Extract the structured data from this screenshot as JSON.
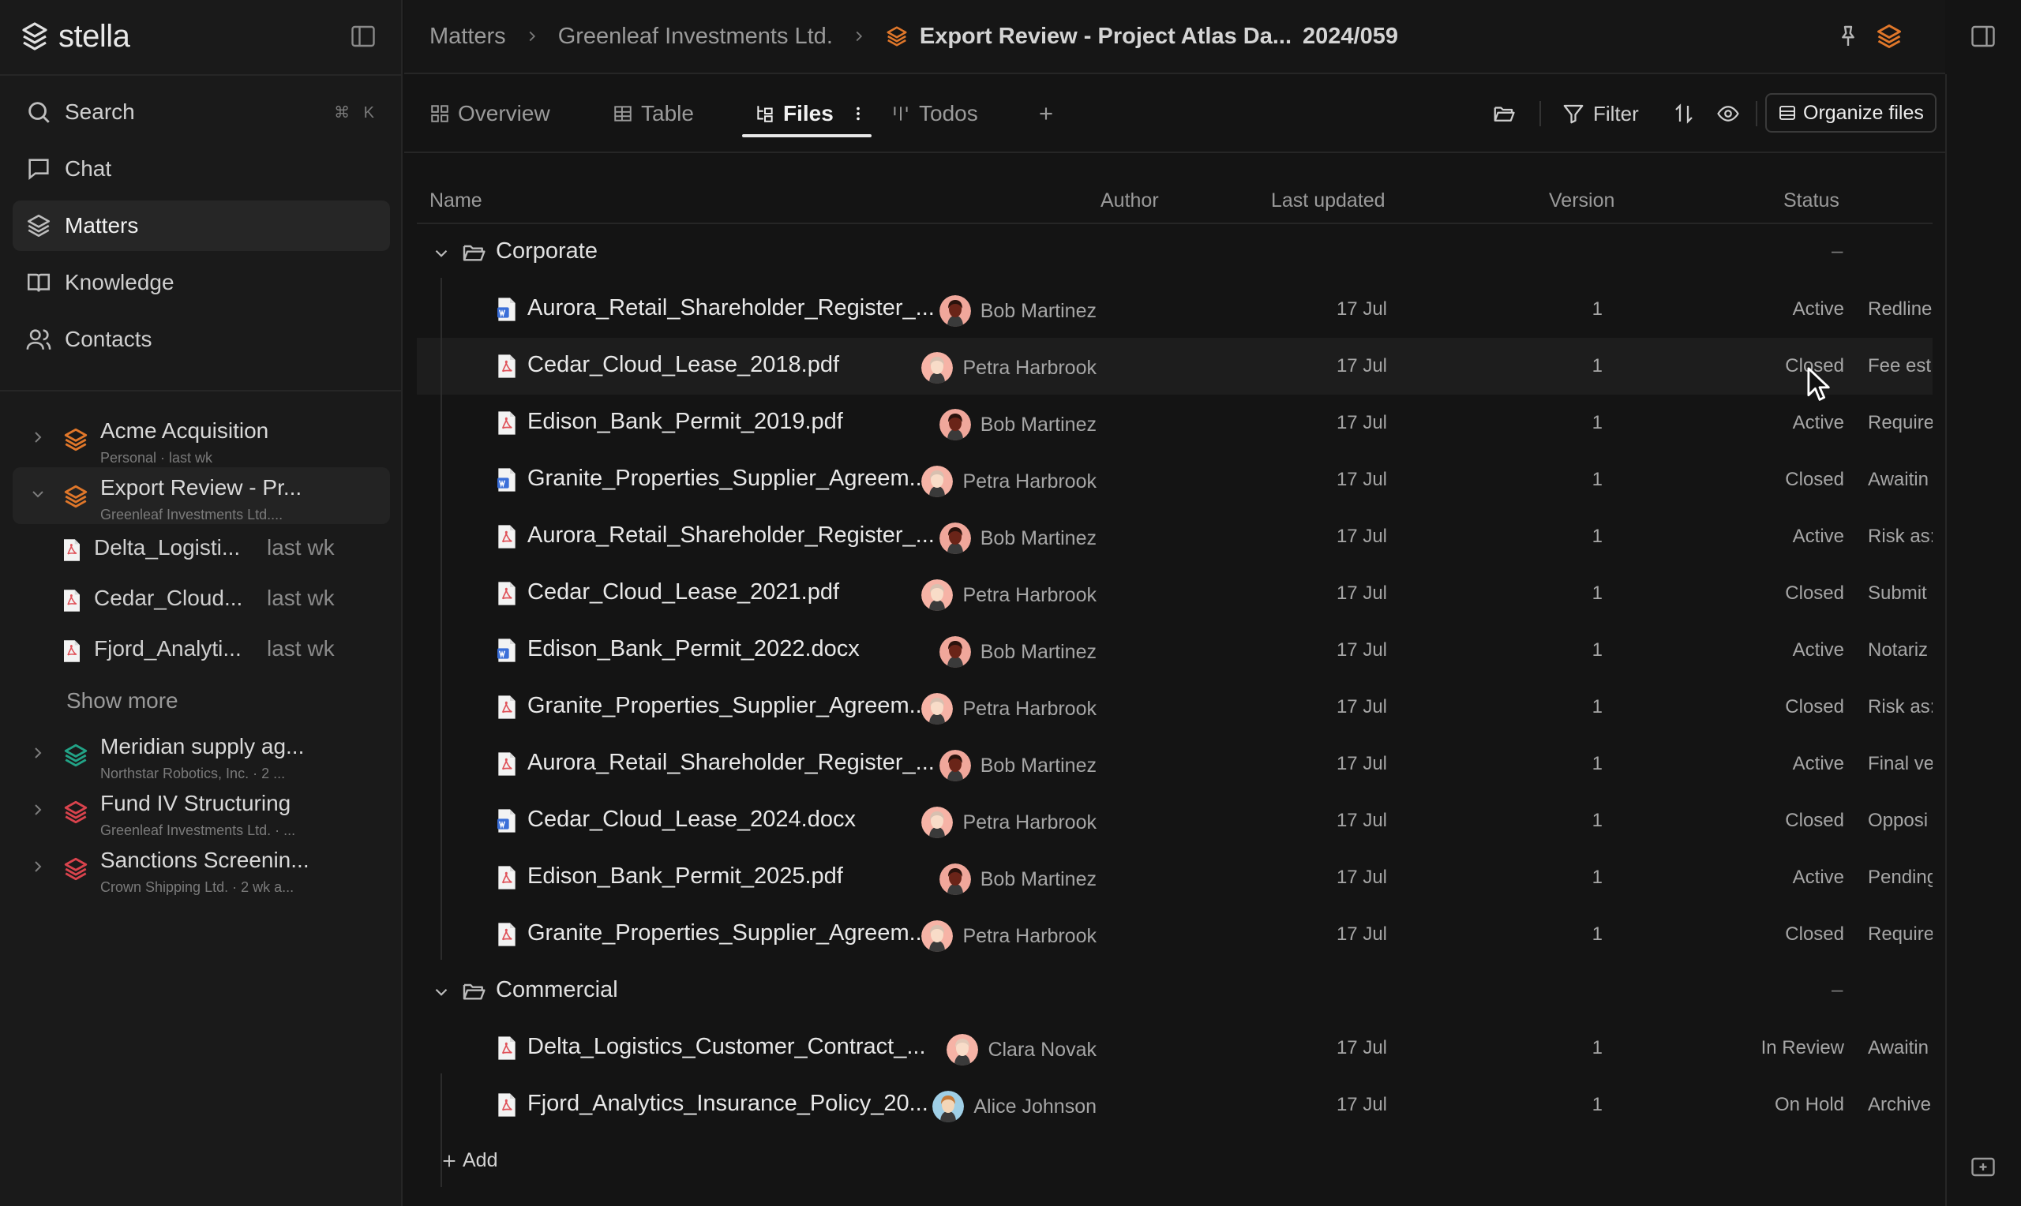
{
  "app": {
    "brand": "stella"
  },
  "nav": {
    "search": "Search",
    "search_shortcut": "⌘ K",
    "chat": "Chat",
    "matters": "Matters",
    "knowledge": "Knowledge",
    "contacts": "Contacts"
  },
  "sidebar_matters": [
    {
      "title": "Acme Acquisition",
      "subtitle": "Personal · last wk",
      "color": "#e0772a"
    },
    {
      "title": "Export Review - Pr...",
      "subtitle": "Greenleaf Investments Ltd....",
      "color": "#e0772a"
    },
    {
      "title": "Meridian supply ag...",
      "subtitle": "Northstar Robotics, Inc. · 2 ...",
      "color": "#22a386"
    },
    {
      "title": "Fund IV Structuring",
      "subtitle": "Greenleaf Investments Ltd. · ...",
      "color": "#d9434d"
    },
    {
      "title": "Sanctions Screenin...",
      "subtitle": "Crown Shipping Ltd. · 2 wk a...",
      "color": "#d9434d"
    }
  ],
  "recent_files": [
    {
      "name": "Delta_Logisti...",
      "time": "last wk"
    },
    {
      "name": "Cedar_Cloud...",
      "time": "last wk"
    },
    {
      "name": "Fjord_Analyti...",
      "time": "last wk"
    }
  ],
  "show_more": "Show more",
  "breadcrumb": {
    "root": "Matters",
    "client": "Greenleaf Investments Ltd.",
    "matter": "Export Review - Project Atlas Da...",
    "matter_number": "2024/059"
  },
  "tabs": {
    "overview": "Overview",
    "table": "Table",
    "files": "Files",
    "todos": "Todos",
    "active": "Files"
  },
  "toolbar": {
    "filter": "Filter",
    "organize": "Organize files"
  },
  "columns": {
    "name": "Name",
    "author": "Author",
    "last_updated": "Last updated",
    "version": "Version",
    "status": "Status"
  },
  "colors": {
    "word": "#3b6fd8",
    "pdf": "#e0535a",
    "accent": "#e0772a"
  },
  "groups": [
    {
      "name": "Corporate",
      "dash": "–",
      "files": [
        {
          "name": "Aurora_Retail_Shareholder_Register_...",
          "type": "word",
          "author": "Bob Martinez",
          "avatar": "bob",
          "updated": "17 Jul",
          "version": "1",
          "status": "Active",
          "notes": "Redline"
        },
        {
          "name": "Cedar_Cloud_Lease_2018.pdf",
          "type": "pdf",
          "author": "Petra Harbrook",
          "avatar": "petra",
          "updated": "17 Jul",
          "version": "1",
          "status": "Closed",
          "notes": "Fee est"
        },
        {
          "name": "Edison_Bank_Permit_2019.pdf",
          "type": "pdf",
          "author": "Bob Martinez",
          "avatar": "bob",
          "updated": "17 Jul",
          "version": "1",
          "status": "Active",
          "notes": "Require"
        },
        {
          "name": "Granite_Properties_Supplier_Agreem...",
          "type": "word",
          "author": "Petra Harbrook",
          "avatar": "petra",
          "updated": "17 Jul",
          "version": "1",
          "status": "Closed",
          "notes": "Awaitin"
        },
        {
          "name": "Aurora_Retail_Shareholder_Register_...",
          "type": "pdf",
          "author": "Bob Martinez",
          "avatar": "bob",
          "updated": "17 Jul",
          "version": "1",
          "status": "Active",
          "notes": "Risk as:"
        },
        {
          "name": "Cedar_Cloud_Lease_2021.pdf",
          "type": "pdf",
          "author": "Petra Harbrook",
          "avatar": "petra",
          "updated": "17 Jul",
          "version": "1",
          "status": "Closed",
          "notes": "Submit"
        },
        {
          "name": "Edison_Bank_Permit_2022.docx",
          "type": "word",
          "author": "Bob Martinez",
          "avatar": "bob",
          "updated": "17 Jul",
          "version": "1",
          "status": "Active",
          "notes": "Notariz"
        },
        {
          "name": "Granite_Properties_Supplier_Agreem...",
          "type": "pdf",
          "author": "Petra Harbrook",
          "avatar": "petra",
          "updated": "17 Jul",
          "version": "1",
          "status": "Closed",
          "notes": "Risk as:"
        },
        {
          "name": "Aurora_Retail_Shareholder_Register_...",
          "type": "pdf",
          "author": "Bob Martinez",
          "avatar": "bob",
          "updated": "17 Jul",
          "version": "1",
          "status": "Active",
          "notes": "Final ve"
        },
        {
          "name": "Cedar_Cloud_Lease_2024.docx",
          "type": "word",
          "author": "Petra Harbrook",
          "avatar": "petra",
          "updated": "17 Jul",
          "version": "1",
          "status": "Closed",
          "notes": "Opposi"
        },
        {
          "name": "Edison_Bank_Permit_2025.pdf",
          "type": "pdf",
          "author": "Bob Martinez",
          "avatar": "bob",
          "updated": "17 Jul",
          "version": "1",
          "status": "Active",
          "notes": "Pending"
        },
        {
          "name": "Granite_Properties_Supplier_Agreem...",
          "type": "pdf",
          "author": "Petra Harbrook",
          "avatar": "petra",
          "updated": "17 Jul",
          "version": "1",
          "status": "Closed",
          "notes": "Require"
        }
      ]
    },
    {
      "name": "Commercial",
      "dash": "–",
      "files": [
        {
          "name": "Delta_Logistics_Customer_Contract_...",
          "type": "pdf",
          "author": "Clara Novak",
          "avatar": "clara",
          "updated": "17 Jul",
          "version": "1",
          "status": "In Review",
          "notes": "Awaitin"
        },
        {
          "name": "Fjord_Analytics_Insurance_Policy_20...",
          "type": "pdf",
          "author": "Alice Johnson",
          "avatar": "alice",
          "updated": "17 Jul",
          "version": "1",
          "status": "On Hold",
          "notes": "Archive"
        }
      ]
    }
  ],
  "add_label": "Add"
}
